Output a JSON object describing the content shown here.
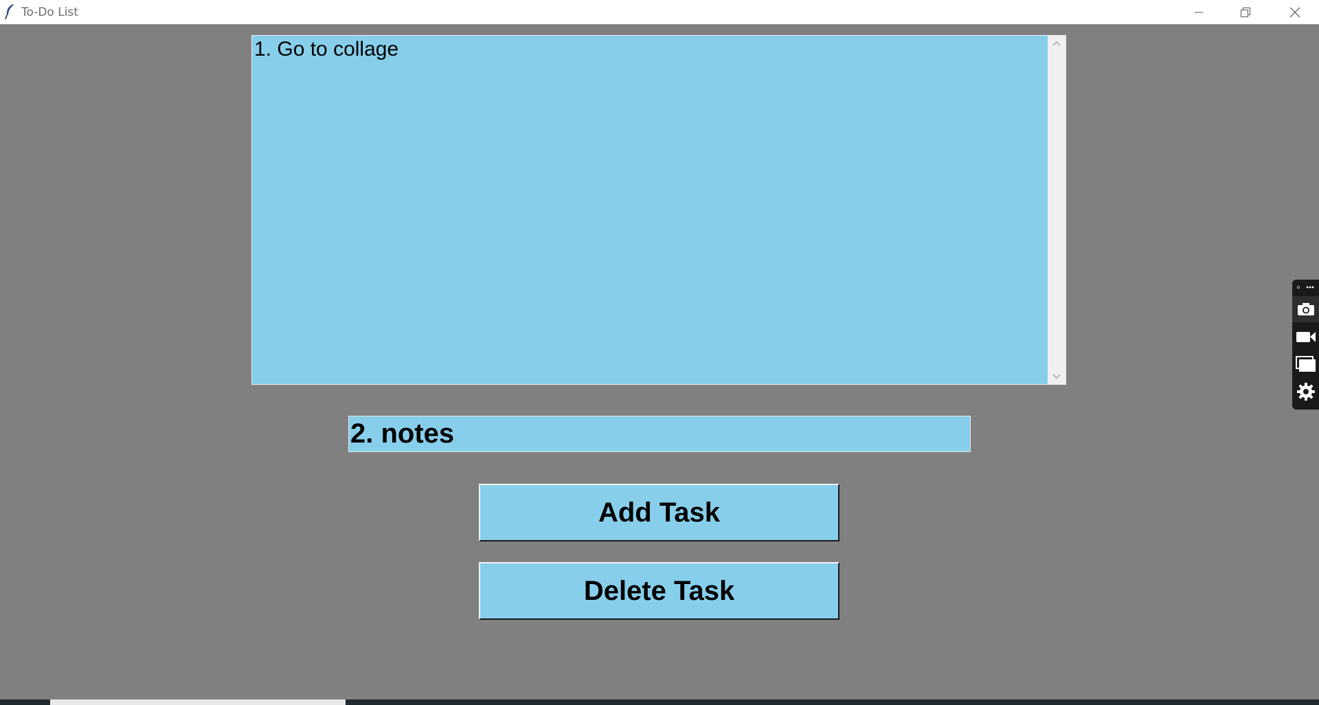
{
  "window": {
    "title": "To-Do List"
  },
  "task_list": {
    "items": [
      "1. Go to collage"
    ]
  },
  "task_entry": {
    "value": "2. notes"
  },
  "buttons": {
    "add_label": "Add Task",
    "delete_label": "Delete Task"
  },
  "capture_toolbar": {
    "icons": [
      "more-icon",
      "camera-icon",
      "video-camera-icon",
      "window-icon",
      "gear-icon"
    ]
  },
  "colors": {
    "background": "#808080",
    "widget": "#87ceeb",
    "toolbar": "#1a1a1a"
  }
}
